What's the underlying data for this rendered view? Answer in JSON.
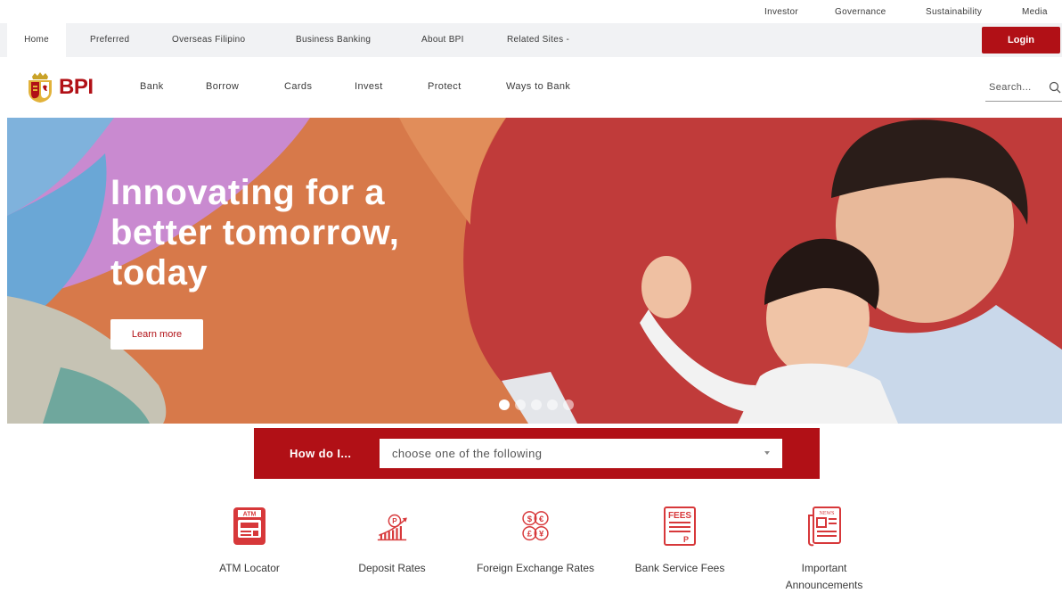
{
  "utility_nav": {
    "items": [
      "Investor",
      "Governance",
      "Sustainability",
      "Media"
    ]
  },
  "section_nav": {
    "items": [
      "Home",
      "Preferred",
      "Overseas Filipino",
      "Business Banking",
      "About BPI",
      "Related Sites"
    ],
    "active": "Home",
    "dropdown_suffix": "-",
    "login_label": "Login"
  },
  "brand": {
    "wordmark": "BPI",
    "primary_color": "#b11016",
    "crest_icon": "lion-crest-icon"
  },
  "main_nav": {
    "items": [
      "Bank",
      "Borrow",
      "Cards",
      "Invest",
      "Protect",
      "Ways to Bank"
    ]
  },
  "search": {
    "placeholder": "Search...",
    "icon": "search-icon"
  },
  "hero": {
    "heading_lines": [
      "Innovating for a",
      "better tomorrow,",
      "today"
    ],
    "cta_label": "Learn more",
    "carousel": {
      "slides": 5,
      "active": 1
    }
  },
  "how_do_i": {
    "label": "How do I...",
    "select_value": "choose one of the following"
  },
  "quick_links": [
    {
      "label": "ATM Locator",
      "icon": "atm-icon"
    },
    {
      "label": "Deposit Rates",
      "icon": "deposit-rates-icon"
    },
    {
      "label": "Foreign Exchange Rates",
      "icon": "currency-icon"
    },
    {
      "label": "Bank Service Fees",
      "icon": "fees-icon"
    },
    {
      "label": "Important Announcements",
      "icon": "news-icon"
    }
  ]
}
